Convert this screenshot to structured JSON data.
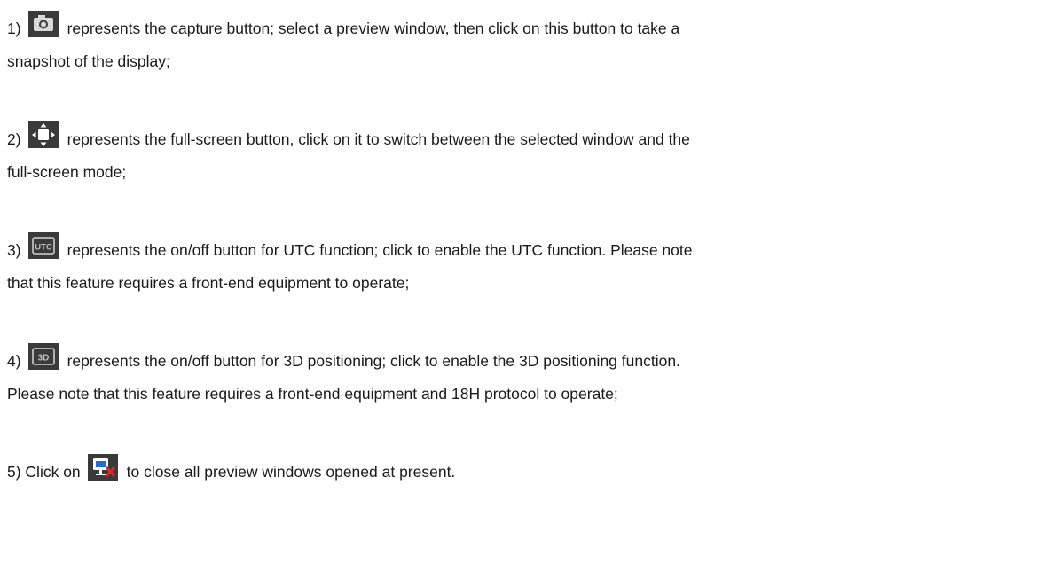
{
  "items": [
    {
      "num": "1)",
      "icon": "camera-icon",
      "text1": "represents the capture button; select a preview window, then click on this button to take a",
      "text2": "snapshot of the display;"
    },
    {
      "num": "2)",
      "icon": "fullscreen-move-icon",
      "text1": "represents the full-screen button, click on it to switch between the selected window and the",
      "text2": "full-screen mode;"
    },
    {
      "num": "3)",
      "icon": "utc-icon",
      "icon_label": "UTC",
      "text1": "represents the on/off button for UTC function; click to enable the UTC function. Please note",
      "text2": "that this feature requires a front-end equipment to operate;"
    },
    {
      "num": "4)",
      "icon": "3d-positioning-icon",
      "icon_label": "3D",
      "text1": "represents the on/off button for 3D positioning; click to enable the 3D positioning function.",
      "text2": "Please note that this feature requires a front-end equipment and 18H protocol to operate;"
    },
    {
      "num_prefix": "5) Click on",
      "icon": "close-all-preview-icon",
      "text1": "to close all preview windows opened at present."
    }
  ],
  "colors": {
    "icon_dark": "#3a3a3a",
    "icon_blue": "#1c6fd1",
    "icon_red": "#e0262b",
    "text": "#1a1a1a"
  }
}
